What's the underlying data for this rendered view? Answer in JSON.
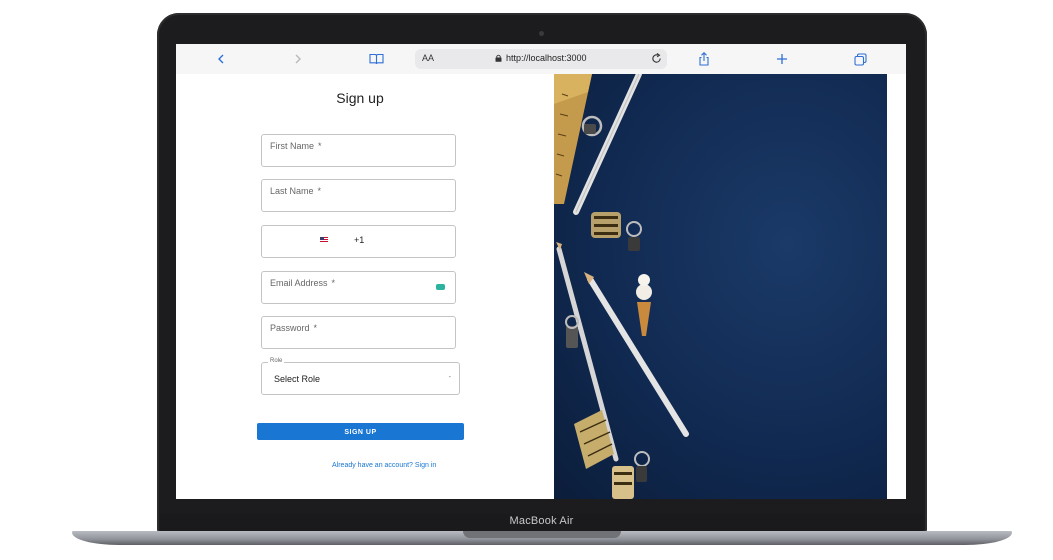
{
  "device": {
    "label": "MacBook Air"
  },
  "browser": {
    "text_size_label": "AA",
    "url": "http://localhost:3000",
    "icons": [
      "back-icon",
      "forward-icon",
      "bookmarks-icon",
      "lock-icon",
      "reload-icon",
      "share-icon",
      "new-tab-icon",
      "tabs-icon"
    ]
  },
  "form": {
    "title": "Sign up",
    "first_name": {
      "label": "First Name",
      "required": "*"
    },
    "last_name": {
      "label": "Last Name",
      "required": "*"
    },
    "phone": {
      "country_code": "+1"
    },
    "email": {
      "label": "Email Address",
      "required": "*"
    },
    "password": {
      "label": "Password",
      "required": "*"
    },
    "role": {
      "label": "Role",
      "value": "Select Role",
      "arrow": "-"
    },
    "submit_label": "SIGN UP",
    "signin_link": "Already have an account? Sign in"
  },
  "colors": {
    "primary": "#1976d2",
    "image_background": "#112a52"
  }
}
